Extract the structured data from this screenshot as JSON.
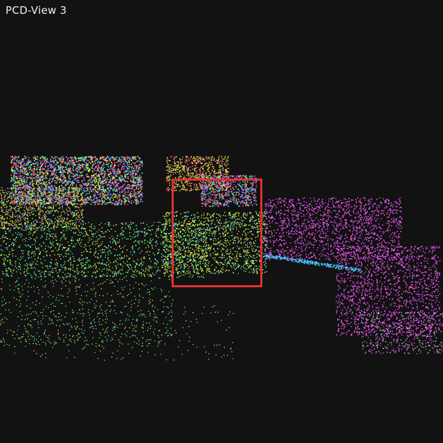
{
  "viewport": {
    "title": "PCD-View 3",
    "background_color": "#121212",
    "selection_box_color": "#e53030"
  }
}
